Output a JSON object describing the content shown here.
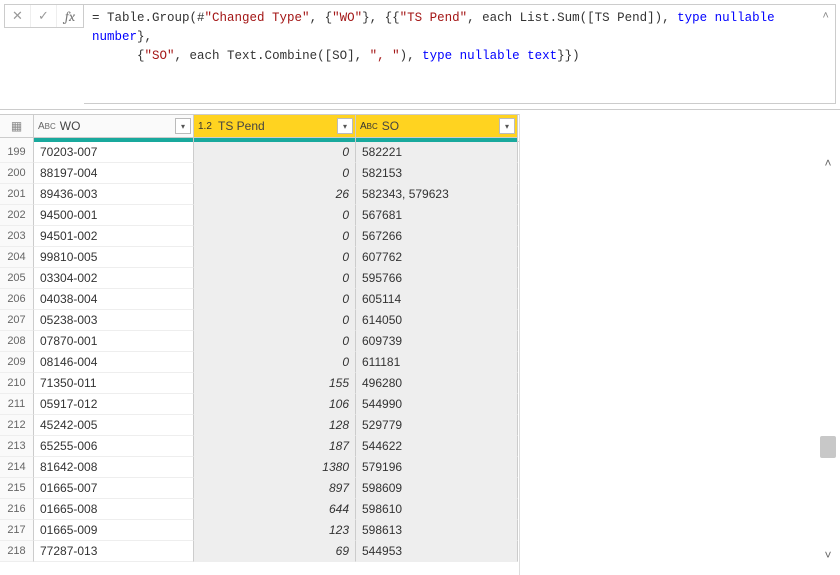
{
  "formula": {
    "prefix": "= Table.Group(#",
    "arg_changed": "\"Changed Type\"",
    "arg_wo": "\"WO\"",
    "arg_tspend": "\"TS Pend\"",
    "each1": ", each List.Sum([TS Pend]), ",
    "type_nullable1": "type nullable ",
    "kw_number": "number",
    "brace_end1": "},",
    "line2_open": "{",
    "arg_so": "\"SO\"",
    "each2": ", each Text.Combine([SO], ",
    "comma_str": "\", \"",
    "each2b": "), ",
    "type_nullable2": "type nullable ",
    "kw_text": "text",
    "brace_end2": "}})"
  },
  "columns": {
    "wo": {
      "label": "WO",
      "type_label": "ABC"
    },
    "ts": {
      "label": "TS Pend",
      "type_label": "1.2"
    },
    "so": {
      "label": "SO",
      "type_label": "ABC"
    }
  },
  "rows": [
    {
      "n": 199,
      "wo": "70203-007",
      "ts": "0",
      "so": "582221"
    },
    {
      "n": 200,
      "wo": "88197-004",
      "ts": "0",
      "so": "582153"
    },
    {
      "n": 201,
      "wo": "89436-003",
      "ts": "26",
      "so": "582343, 579623"
    },
    {
      "n": 202,
      "wo": "94500-001",
      "ts": "0",
      "so": "567681"
    },
    {
      "n": 203,
      "wo": "94501-002",
      "ts": "0",
      "so": "567266"
    },
    {
      "n": 204,
      "wo": "99810-005",
      "ts": "0",
      "so": "607762"
    },
    {
      "n": 205,
      "wo": "03304-002",
      "ts": "0",
      "so": "595766"
    },
    {
      "n": 206,
      "wo": "04038-004",
      "ts": "0",
      "so": "605114"
    },
    {
      "n": 207,
      "wo": "05238-003",
      "ts": "0",
      "so": "614050"
    },
    {
      "n": 208,
      "wo": "07870-001",
      "ts": "0",
      "so": "609739"
    },
    {
      "n": 209,
      "wo": "08146-004",
      "ts": "0",
      "so": "611181"
    },
    {
      "n": 210,
      "wo": "71350-011",
      "ts": "155",
      "so": "496280"
    },
    {
      "n": 211,
      "wo": "05917-012",
      "ts": "106",
      "so": "544990"
    },
    {
      "n": 212,
      "wo": "45242-005",
      "ts": "128",
      "so": "529779"
    },
    {
      "n": 213,
      "wo": "65255-006",
      "ts": "187",
      "so": "544622"
    },
    {
      "n": 214,
      "wo": "81642-008",
      "ts": "1380",
      "so": "579196"
    },
    {
      "n": 215,
      "wo": "01665-007",
      "ts": "897",
      "so": "598609"
    },
    {
      "n": 216,
      "wo": "01665-008",
      "ts": "644",
      "so": "598610"
    },
    {
      "n": 217,
      "wo": "01665-009",
      "ts": "123",
      "so": "598613"
    },
    {
      "n": 218,
      "wo": "77287-013",
      "ts": "69",
      "so": "544953"
    }
  ],
  "icons": {
    "cancel": "✕",
    "commit": "✓",
    "fx": "fx",
    "filter_glyph": "▾",
    "chev_up": "˄",
    "chev_down": "˅",
    "table_ico": "▦"
  }
}
